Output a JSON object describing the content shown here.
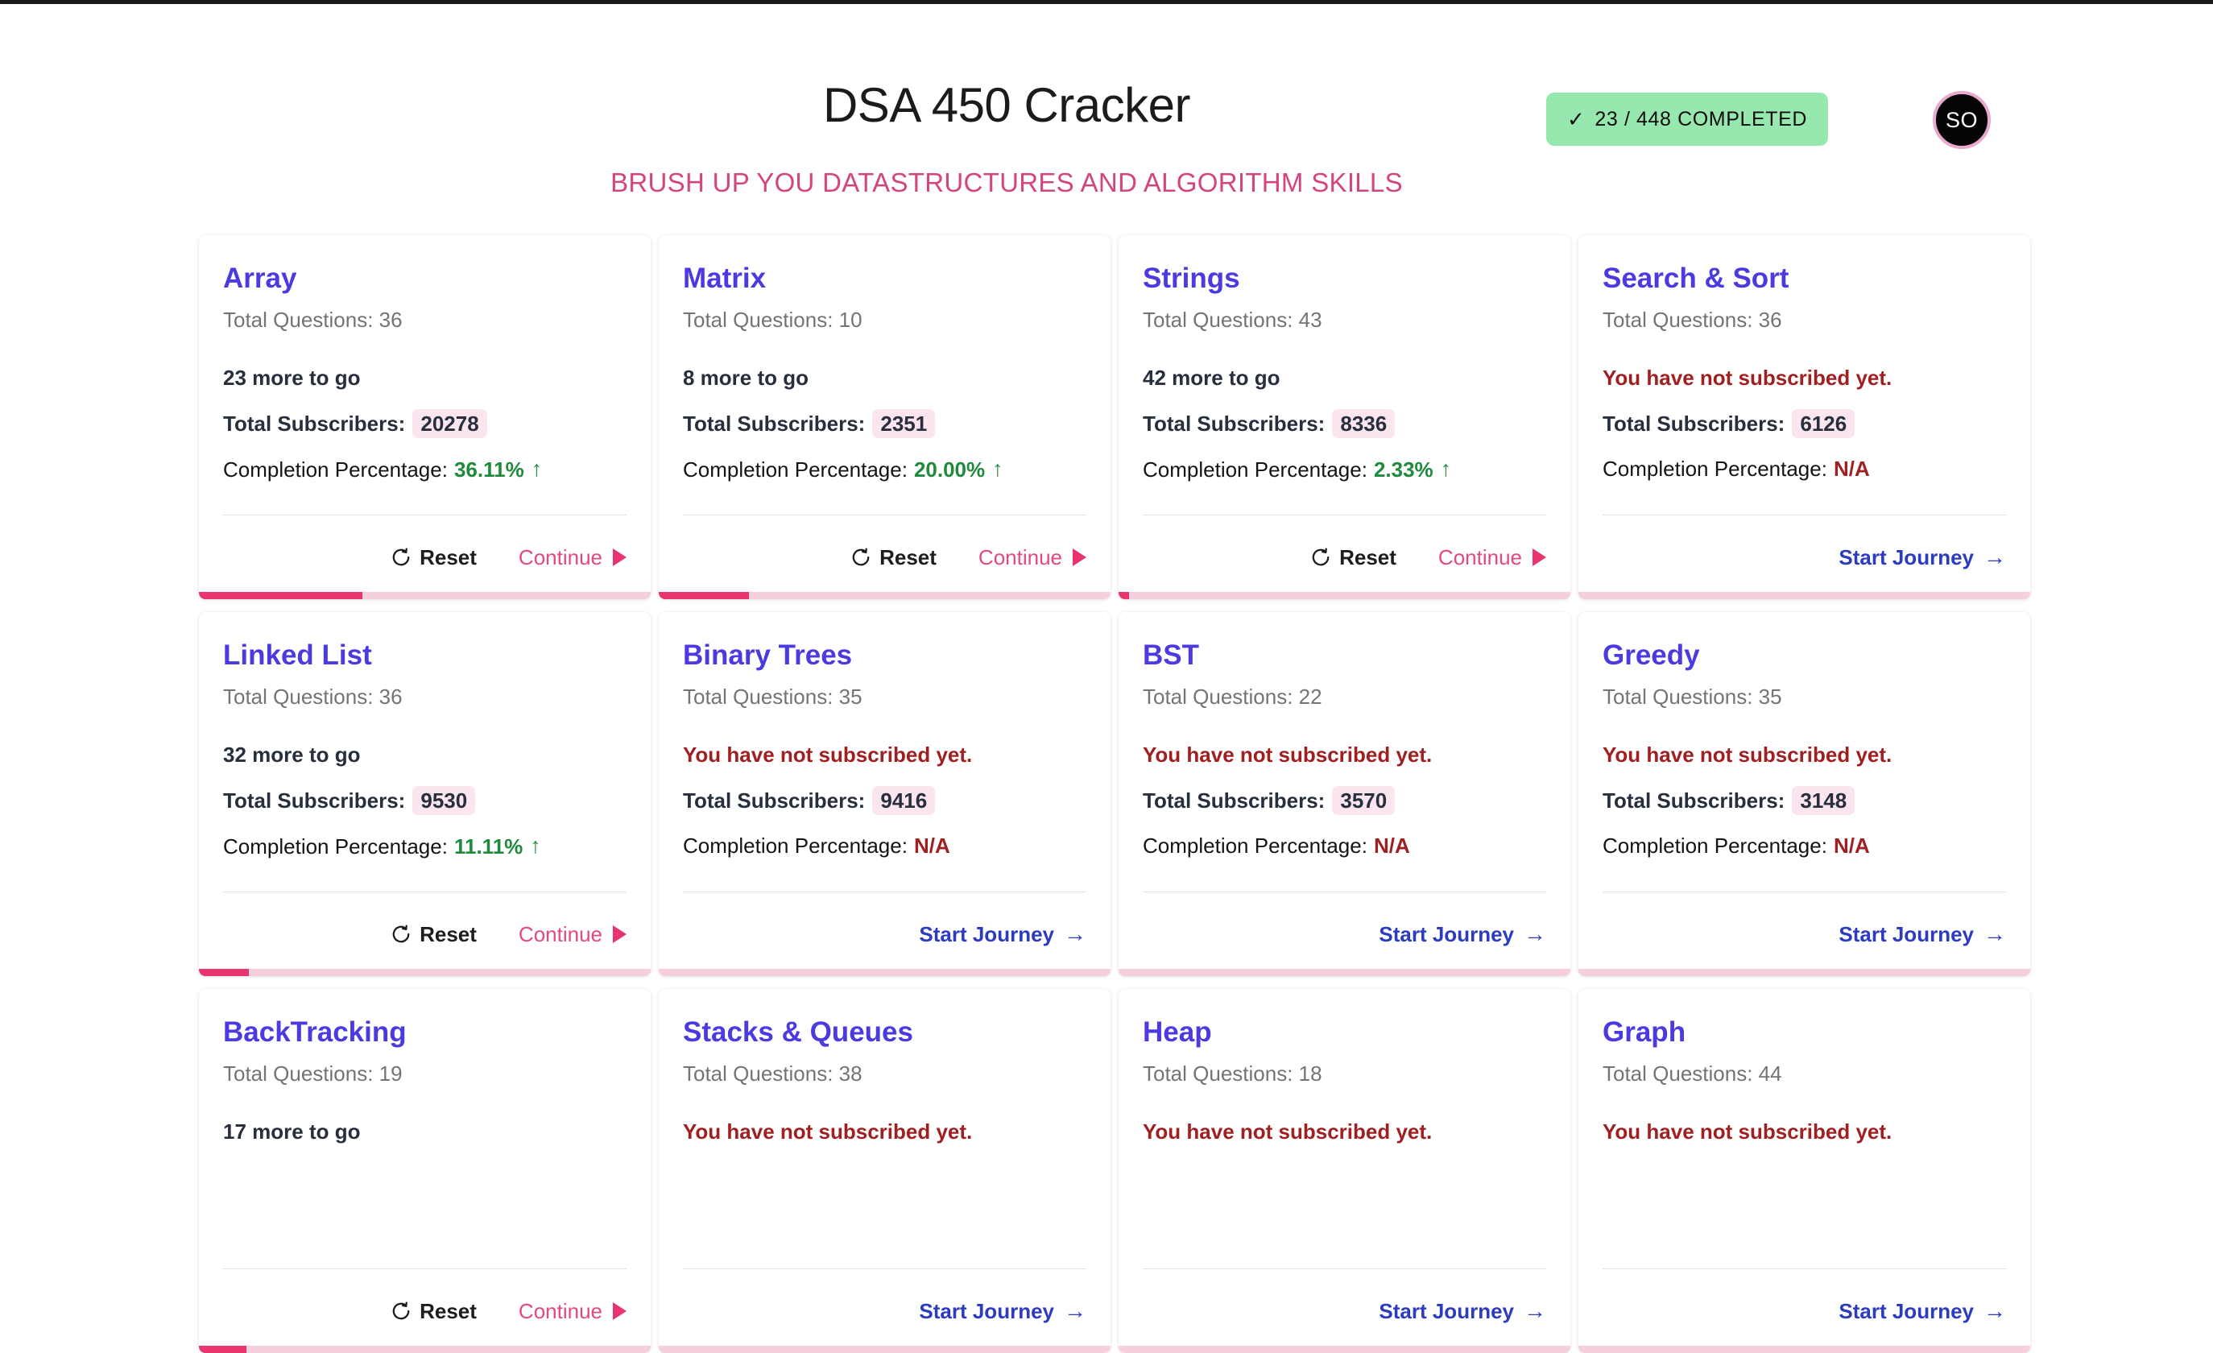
{
  "header": {
    "title": "DSA 450 Cracker",
    "subtitle": "BRUSH UP YOU DATASTRUCTURES AND ALGORITHM SKILLS",
    "badge": {
      "check_icon": "check-icon",
      "text": "23 / 448 COMPLETED",
      "bg_color": "#97e8ae"
    },
    "avatar": {
      "initials": "SO",
      "bg_color": "#050505",
      "border_color": "#e8a9cd"
    }
  },
  "labels": {
    "total_questions_prefix": "Total Questions:",
    "total_subscribers_label": "Total Subscribers:",
    "completion_label": "Completion Percentage:",
    "not_subscribed": "You have not subscribed yet.",
    "more_to_go_suffix": "more to go",
    "reset": "Reset",
    "continue": "Continue",
    "start_journey": "Start Journey",
    "na": "N/A",
    "up_arrow": "↑",
    "right_arrow": "→"
  },
  "colors": {
    "card_title": "#4a3ae0",
    "accent_pink": "#e8356d",
    "progress_track": "#f6cede",
    "success_green": "#1f8a3c",
    "danger_red": "#a01f20",
    "link_blue": "#2c3bbf",
    "subtitle_pink": "#d2457e"
  },
  "cards": [
    {
      "title": "Array",
      "total_questions": 36,
      "subscribed": true,
      "status_text": "23 more to go",
      "subscribers": "20278",
      "completion": "36.11%",
      "progress_pct": 36.11,
      "primary_action": "Continue",
      "secondary_action": "Reset"
    },
    {
      "title": "Matrix",
      "total_questions": 10,
      "subscribed": true,
      "status_text": "8 more to go",
      "subscribers": "2351",
      "completion": "20.00%",
      "progress_pct": 20.0,
      "primary_action": "Continue",
      "secondary_action": "Reset"
    },
    {
      "title": "Strings",
      "total_questions": 43,
      "subscribed": true,
      "status_text": "42 more to go",
      "subscribers": "8336",
      "completion": "2.33%",
      "progress_pct": 2.33,
      "primary_action": "Continue",
      "secondary_action": "Reset"
    },
    {
      "title": "Search & Sort",
      "total_questions": 36,
      "subscribed": false,
      "status_text": "You have not subscribed yet.",
      "subscribers": "6126",
      "completion": "N/A",
      "progress_pct": 0,
      "primary_action": "Start Journey",
      "secondary_action": null
    },
    {
      "title": "Linked List",
      "total_questions": 36,
      "subscribed": true,
      "status_text": "32 more to go",
      "subscribers": "9530",
      "completion": "11.11%",
      "progress_pct": 11.11,
      "primary_action": "Continue",
      "secondary_action": "Reset"
    },
    {
      "title": "Binary Trees",
      "total_questions": 35,
      "subscribed": false,
      "status_text": "You have not subscribed yet.",
      "subscribers": "9416",
      "completion": "N/A",
      "progress_pct": 0,
      "primary_action": "Start Journey",
      "secondary_action": null
    },
    {
      "title": "BST",
      "total_questions": 22,
      "subscribed": false,
      "status_text": "You have not subscribed yet.",
      "subscribers": "3570",
      "completion": "N/A",
      "progress_pct": 0,
      "primary_action": "Start Journey",
      "secondary_action": null
    },
    {
      "title": "Greedy",
      "total_questions": 35,
      "subscribed": false,
      "status_text": "You have not subscribed yet.",
      "subscribers": "3148",
      "completion": "N/A",
      "progress_pct": 0,
      "primary_action": "Start Journey",
      "secondary_action": null
    },
    {
      "title": "BackTracking",
      "total_questions": 19,
      "subscribed": true,
      "status_text": "17 more to go",
      "subscribers": "",
      "completion": "",
      "progress_pct": 10.5,
      "primary_action": "Continue",
      "secondary_action": "Reset"
    },
    {
      "title": "Stacks & Queues",
      "total_questions": 38,
      "subscribed": false,
      "status_text": "You have not subscribed yet.",
      "subscribers": "",
      "completion": "",
      "progress_pct": 0,
      "primary_action": "Start Journey",
      "secondary_action": null
    },
    {
      "title": "Heap",
      "total_questions": 18,
      "subscribed": false,
      "status_text": "You have not subscribed yet.",
      "subscribers": "",
      "completion": "",
      "progress_pct": 0,
      "primary_action": "Start Journey",
      "secondary_action": null
    },
    {
      "title": "Graph",
      "total_questions": 44,
      "subscribed": false,
      "status_text": "You have not subscribed yet.",
      "subscribers": "",
      "completion": "",
      "progress_pct": 0,
      "primary_action": "Start Journey",
      "secondary_action": null
    }
  ]
}
